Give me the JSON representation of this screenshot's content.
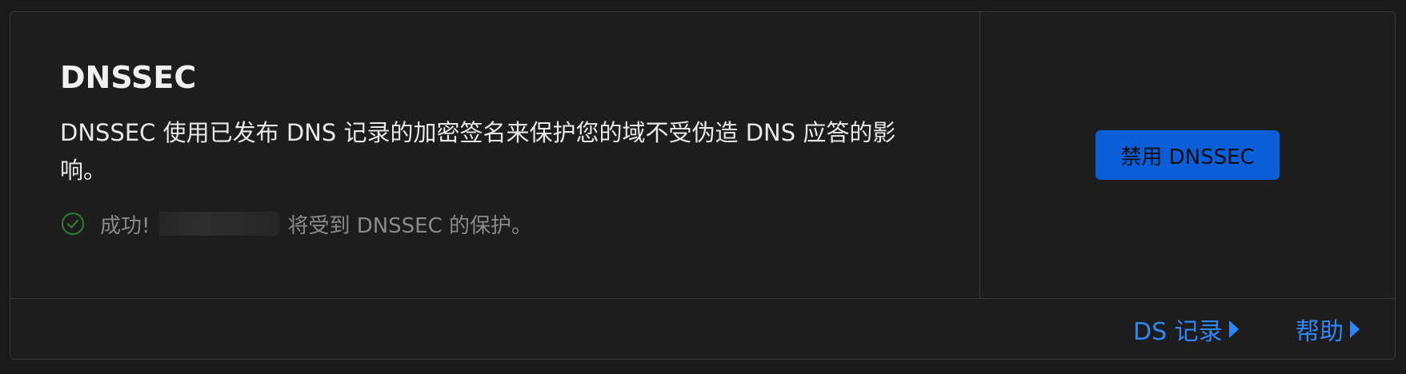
{
  "card": {
    "title": "DNSSEC",
    "description": "DNSSEC 使用已发布 DNS 记录的加密签名来保护您的域不受伪造 DNS 应答的影响。",
    "status": {
      "icon": "check-circle-icon",
      "prefix": "成功!",
      "suffix": "将受到 DNSSEC 的保护。",
      "color": "#2e7d32"
    },
    "action_button": {
      "label": "禁用 DNSSEC",
      "color": "#0a5fd9"
    }
  },
  "footer": {
    "links": [
      {
        "label": "DS 记录",
        "icon": "caret-right-icon"
      },
      {
        "label": "帮助",
        "icon": "caret-right-icon"
      }
    ],
    "link_color": "#2f86f6"
  }
}
